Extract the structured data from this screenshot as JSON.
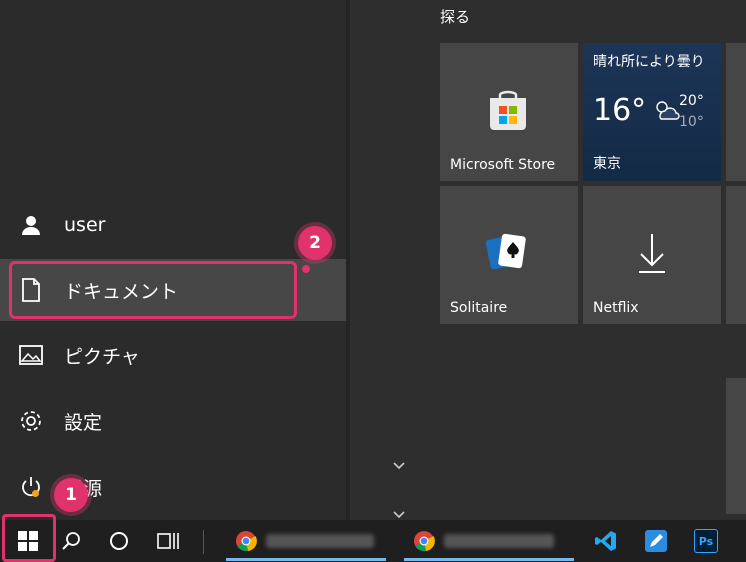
{
  "left_menu": {
    "items": [
      {
        "id": "user",
        "label": "user",
        "icon": "user-icon"
      },
      {
        "id": "documents",
        "label": "ドキュメント",
        "icon": "document-icon"
      },
      {
        "id": "pictures",
        "label": "ピクチャ",
        "icon": "picture-icon"
      },
      {
        "id": "settings",
        "label": "設定",
        "icon": "gear-icon"
      },
      {
        "id": "power",
        "label": "電源",
        "icon": "power-icon"
      }
    ]
  },
  "annotations": {
    "badge1": "1",
    "badge2": "2",
    "accent": "#e0336c"
  },
  "tiles": {
    "section_title": "探る",
    "store": {
      "label": "Microsoft Store"
    },
    "weather": {
      "condition": "晴れ所により曇り",
      "temp": "16°",
      "high": "20°",
      "low": "10°",
      "city": "東京"
    },
    "solitaire": {
      "label": "Solitaire"
    },
    "netflix": {
      "label": "Netflix"
    }
  },
  "taskbar": {
    "items": [
      "windows-start-icon",
      "search-icon",
      "cortana-icon",
      "task-view-icon",
      "chrome-icon",
      "chrome-icon",
      "vscode-icon",
      "edit-app-icon",
      "photoshop-icon"
    ],
    "ps_label": "Ps"
  }
}
